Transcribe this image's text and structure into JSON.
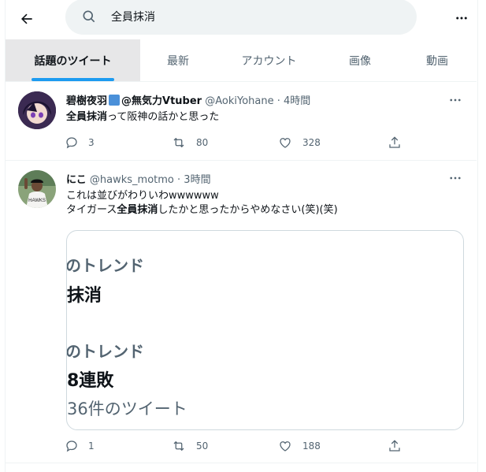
{
  "header": {
    "search_value": "全員抹消"
  },
  "tabs": [
    {
      "label": "話題のツイート",
      "active": true
    },
    {
      "label": "最新"
    },
    {
      "label": "アカウント"
    },
    {
      "label": "画像"
    },
    {
      "label": "動画"
    }
  ],
  "tweets": [
    {
      "name": "碧樹夜羽",
      "name_suffix": "@無気力Vtuber",
      "handle": "@AokiYohane",
      "sep": "·",
      "time": "4時間",
      "text_highlight": "全員抹消",
      "text_rest": "って阪神の話かと思った",
      "replies": "3",
      "retweets": "80",
      "likes": "328"
    },
    {
      "name": "にこ",
      "handle": "@hawks_motmo",
      "sep": "·",
      "time": "3時間",
      "line1": "これは並びがわりいわwwwwww",
      "line2_pre": "タイガース",
      "line2_highlight": "全員抹消",
      "line2_post": "したかと思ったからやめなさい(笑)(笑)",
      "card": {
        "trend1_label": "のトレンド",
        "trend1_value": "抹消",
        "trend2_label": "のトレンド",
        "trend2_value": "8連敗",
        "tweet_count": "36件のツイート"
      },
      "replies": "1",
      "retweets": "50",
      "likes": "188"
    }
  ],
  "colors": {
    "accent": "#1d9bf0",
    "secondary_text": "#536471",
    "active_tab_bg": "#e7e7e8"
  }
}
